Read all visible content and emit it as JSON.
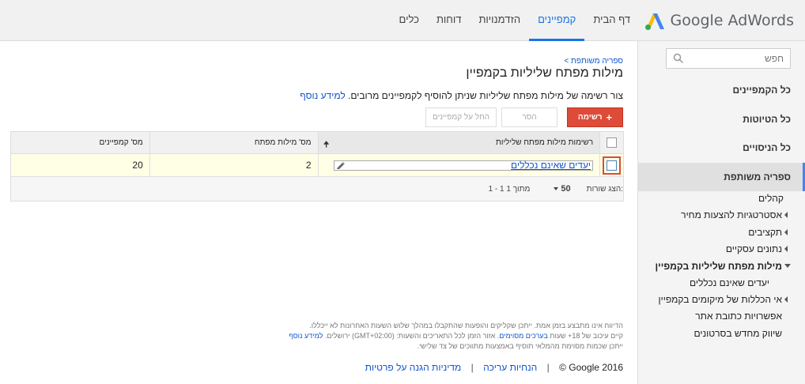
{
  "brand": {
    "logo_text": "Google AdWords",
    "accent": "#1a73e8"
  },
  "nav": {
    "tabs": [
      {
        "label": "דף הבית"
      },
      {
        "label": "קמפיינים",
        "active": true
      },
      {
        "label": "הזדמנויות"
      },
      {
        "label": "דוחות"
      },
      {
        "label": "כלים"
      }
    ]
  },
  "sidebar": {
    "search_placeholder": "חפש",
    "main_items": [
      {
        "label": "כל הקמפיינים"
      },
      {
        "label": "כל הטיוטות"
      },
      {
        "label": "כל הניסויים"
      },
      {
        "label": "ספריה משותפת",
        "active": true
      }
    ],
    "sub_items": [
      {
        "label": "קהלים"
      },
      {
        "label": "אסטרטגיות להצעות מחיר"
      },
      {
        "label": "תקציבים"
      },
      {
        "label": "נתונים עסקיים"
      },
      {
        "label": "מילות מפתח שליליות בקמפיין"
      },
      {
        "label": "יעדים שאינם נכללים"
      },
      {
        "label": "אי הכללות של מיקומים בקמפיין"
      },
      {
        "label": "אפשרויות כתובת אתר"
      },
      {
        "label": "שיווק מחדש בסרטונים"
      }
    ]
  },
  "main": {
    "breadcrumb": "ספריה משותפת >",
    "title": "מילות מפתח שליליות בקמפיין",
    "description": "צור רשימה של מילות מפתח שליליות שניתן להוסיף לקמפיינים מרובים.",
    "learn_more": "למידע נוסף",
    "toolbar": {
      "add_label": "רשימה",
      "remove_label": "הסר",
      "apply_label": "החל על קמפיינים"
    },
    "table": {
      "headers": [
        "רשימות מילות מפתח שליליות",
        "מס' מילות מפתח",
        "מס' קמפיינים"
      ],
      "rows": [
        {
          "name": "יעדים שאינם נכללים",
          "keywords": "2",
          "campaigns": "20"
        }
      ],
      "footer": {
        "rows_label": "הצג שורות:",
        "rows_value": "50",
        "range": "1 - 1 מתוך 1"
      }
    }
  },
  "footer": {
    "disclaimer_1": "הדיווח אינו מתבצע בזמן אמת. ייתכן שקליקים והופעות שהתקבלו במהלך שלוש השעות האחרונות לא ייכללו.",
    "disclaimer_2a": "קיים עיכוב של 18+ שעות",
    "disclaimer_2_link": "בערכים מסוימים",
    "disclaimer_2b": ". אזור הזמן לכל התאריכים והשעות: (GMT+02:00) ירושלים.",
    "disclaimer_2_more": "למידע נוסף",
    "disclaimer_3": "ייתכן שכמות מסוימת מהמלאי תוסיף באמצעות מתווכים של צד שלישי.",
    "copyright": "© Google 2016",
    "edit_guidelines": "הנחיות עריכה",
    "privacy": "מדיניות הגנה על פרטיות"
  }
}
